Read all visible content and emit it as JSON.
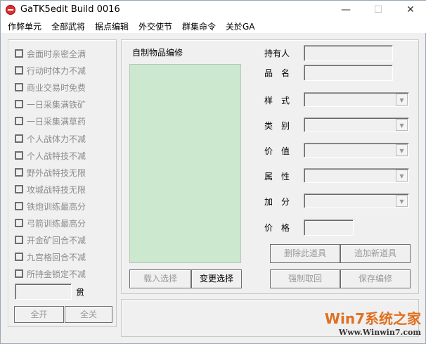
{
  "window": {
    "title": "GaTK5edit Build 0016",
    "minimize": "—",
    "maximize": "☐",
    "close": "✕"
  },
  "menu": [
    "作弊单元",
    "全部武将",
    "据点编辑",
    "外交使节",
    "群集命令",
    "关於GA"
  ],
  "cheats": {
    "options": [
      "会面时亲密全满",
      "行动时体力不减",
      "商业交易时免费",
      "一日采集满铁矿",
      "一日采集满草药",
      "个人战体力不减",
      "个人战特技不减",
      "野外战特技无限",
      "攻城战特技无限",
      "铁炮训练最高分",
      "弓箭训练最高分",
      "开金矿回合不减",
      "九宫格回合不减",
      "所持金锁定不减"
    ],
    "money_value": "",
    "money_unit": "贯",
    "all_on": "全开",
    "all_off": "全关"
  },
  "items": {
    "title": "自制物品编修",
    "load": "载入选择",
    "change": "变更选择",
    "fields": {
      "owner": "持有人",
      "name": "品　名",
      "style": "样　式",
      "category": "类　别",
      "value": "价　值",
      "attribute": "属　性",
      "bonus": "加　分",
      "price": "价　格"
    },
    "values": {
      "owner": "",
      "name": "",
      "price": ""
    },
    "delete": "删除此道具",
    "add": "追加新道具",
    "force_back": "强制取回",
    "save": "保存编修"
  },
  "watermark": {
    "brand": "Win7系统之家",
    "url": "Www.Winwin7.com"
  },
  "colors": {
    "list_bg": "#cce8cf"
  }
}
